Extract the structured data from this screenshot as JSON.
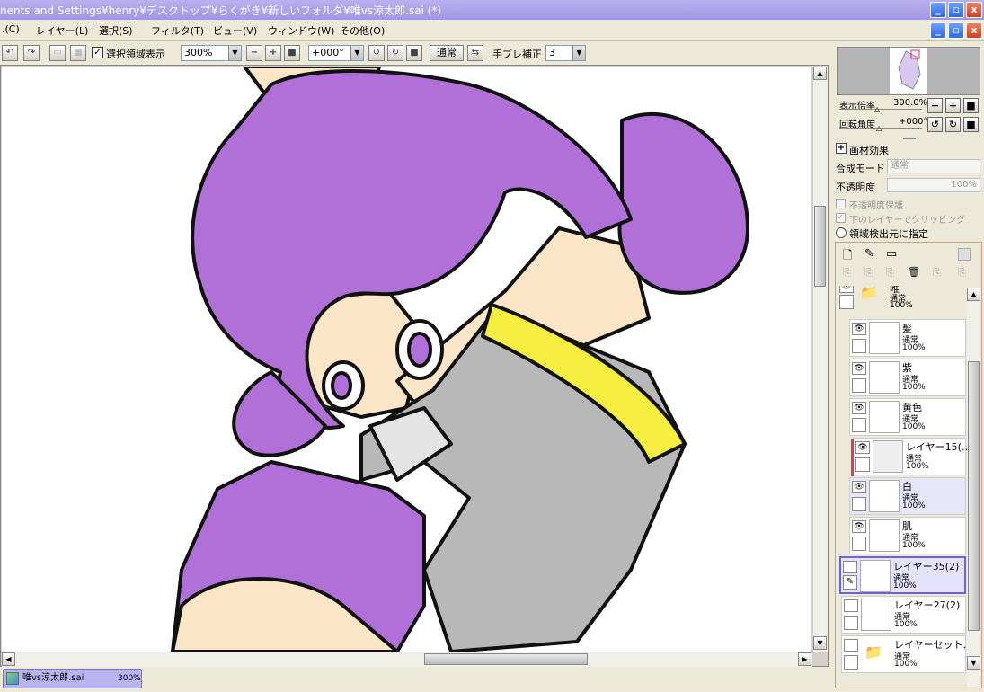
{
  "titlebar": {
    "title": "nents and Settings¥henry¥デスクトップ¥らくがき¥新しいフォルダ¥唯vs涼太郎.sai (*)",
    "minimize": "_",
    "maximize": "▫",
    "close": "x"
  },
  "menubar": {
    "items": [
      ".(C)",
      "レイヤー(L)",
      "選択(S)",
      "フィルタ(T)",
      "ビュー(V)",
      "ウィンドウ(W)",
      "その他(O)"
    ],
    "minimize": "_",
    "maximize": "▫",
    "close": "x"
  },
  "toolbar": {
    "selection_display_label": "選択領域表示",
    "selection_display_checked": true,
    "zoom_value": "300%",
    "rotation_value": "+000°",
    "blend_label": "通常",
    "stabilizer_label": "手ブレ補正",
    "stabilizer_value": "3"
  },
  "navigator": {
    "zoom_label": "表示倍率",
    "zoom_value": "300.0%",
    "rotation_label": "回転角度",
    "rotation_value": "+000°"
  },
  "properties": {
    "effects_label": "画材効果",
    "blend_mode_label": "合成モード",
    "blend_mode_value": "通常",
    "opacity_label": "不透明度",
    "opacity_value": "100%",
    "protect_opacity_label": "不透明度保護",
    "clip_label": "下のレイヤーでクリッピング",
    "selection_source_label": "領域検出元に指定"
  },
  "layers": [
    {
      "name": "唯",
      "mode": "通常",
      "opacity": "100%",
      "kind": "folder",
      "visible": true
    },
    {
      "name": "髪",
      "mode": "通常",
      "opacity": "100%",
      "kind": "layer",
      "visible": true
    },
    {
      "name": "紫",
      "mode": "通常",
      "opacity": "100%",
      "kind": "layer",
      "visible": true
    },
    {
      "name": "黄色",
      "mode": "通常",
      "opacity": "100%",
      "kind": "layer",
      "visible": true
    },
    {
      "name": "レイヤー15(…",
      "mode": "通常",
      "opacity": "100%",
      "kind": "layer",
      "visible": true
    },
    {
      "name": "白",
      "mode": "通常",
      "opacity": "100%",
      "kind": "layer",
      "visible": true
    },
    {
      "name": "肌",
      "mode": "通常",
      "opacity": "100%",
      "kind": "layer",
      "visible": true
    },
    {
      "name": "レイヤー35(2)",
      "mode": "通常",
      "opacity": "100%",
      "kind": "layer",
      "visible": false
    },
    {
      "name": "レイヤー27(2)",
      "mode": "通常",
      "opacity": "100%",
      "kind": "layer",
      "visible": false
    },
    {
      "name": "レイヤーセット…",
      "mode": "通常",
      "opacity": "100%",
      "kind": "folder",
      "visible": false
    }
  ],
  "taskbar": {
    "doc_name": "唯vs涼太郎.sai",
    "doc_zoom": "300%"
  },
  "colors": {
    "hair": "#b070d8",
    "skin": "#fde5c8",
    "sleeve": "#b8b8b8",
    "ring": "#f5ee40",
    "title": "#a49be6"
  }
}
